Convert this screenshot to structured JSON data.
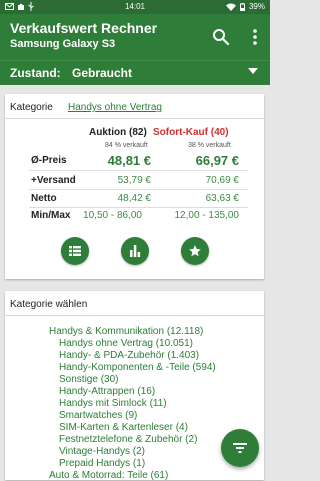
{
  "status": {
    "time": "14:01",
    "battery": "39%"
  },
  "app": {
    "title": "Verkaufswert Rechner",
    "subtitle": "Samsung Galaxy S3"
  },
  "state": {
    "label": "Zustand:",
    "value": "Gebraucht"
  },
  "category": {
    "label": "Kategorie",
    "value": "Handys ohne Vertrag"
  },
  "results": {
    "auction": {
      "title": "Auktion (82)",
      "percent": "84 % verkauft"
    },
    "instant": {
      "title": "Sofort-Kauf (40)",
      "percent": "38 % verkauft"
    },
    "rows": [
      {
        "label": "Ø-Preis",
        "auction": "48,81 €",
        "instant": "66,97 €"
      },
      {
        "label": "+Versand",
        "auction": "53,79 €",
        "instant": "70,69 €"
      },
      {
        "label": "Netto",
        "auction": "48,42 €",
        "instant": "63,63 €"
      },
      {
        "label": "Min/Max",
        "auction": "10,50 - 86,00",
        "instant": "12,00 - 135,00"
      }
    ]
  },
  "actions": [
    "list-icon",
    "bar-chart-icon",
    "star-icon"
  ],
  "catlist": {
    "title": "Kategorie wählen",
    "items": [
      {
        "text": "Handys & Kommunikation (12.118)",
        "level": 1
      },
      {
        "text": "Handys ohne Vertrag (10.051)",
        "level": 2
      },
      {
        "text": "Handy- & PDA-Zubehör (1.403)",
        "level": 2
      },
      {
        "text": "Handy-Komponenten & -Teile (594)",
        "level": 2
      },
      {
        "text": "Sonstige (30)",
        "level": 2
      },
      {
        "text": "Handy-Attrappen (16)",
        "level": 2
      },
      {
        "text": "Handys mit Simlock (11)",
        "level": 2
      },
      {
        "text": "Smartwatches (9)",
        "level": 2
      },
      {
        "text": "SIM-Karten & Kartenleser (4)",
        "level": 2
      },
      {
        "text": "Festnetztelefone & Zubehör (2)",
        "level": 2
      },
      {
        "text": "Vintage-Handys (2)",
        "level": 2
      },
      {
        "text": "Prepaid Handys (1)",
        "level": 2
      },
      {
        "text": "Auto & Motorrad: Teile (61)",
        "level": 1
      }
    ]
  },
  "colors": {
    "primary": "#2e7d38",
    "statusbar": "#2b6b34",
    "red": "#d32f2f"
  }
}
